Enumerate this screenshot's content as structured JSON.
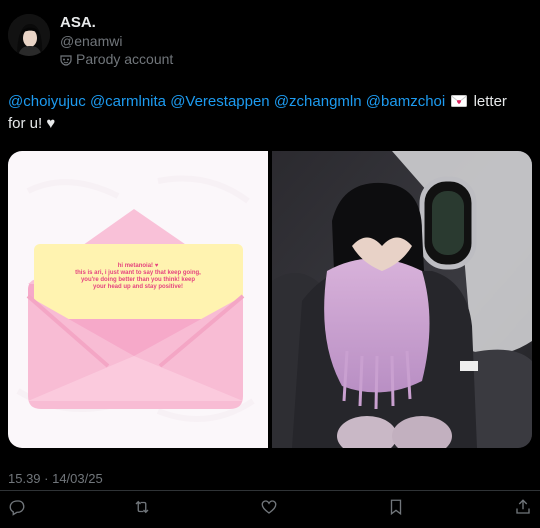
{
  "author": {
    "name": "ASA.",
    "handle": "@enamwi",
    "label": "Parody account",
    "label_icon": "mask-icon"
  },
  "tweet": {
    "mentions": [
      "@choiyujuc",
      "@carmlnita",
      "@Verestappen",
      "@zchangmln",
      "@bamzchoi"
    ],
    "emoji": "love-letter-emoji",
    "line_end": "letter",
    "line2": "for u! ♥"
  },
  "media": {
    "left_letter": {
      "greeting": "hi metanoia! ♥",
      "line1": "this is ari, i just want to say that keep going,",
      "line2": "you're doing better than you think! keep",
      "line3": "your head up and stay positive!"
    }
  },
  "timestamp": "15.39 · 14/03/25",
  "actions": [
    {
      "name": "reply-icon"
    },
    {
      "name": "retweet-icon"
    },
    {
      "name": "like-icon"
    },
    {
      "name": "bookmark-icon"
    },
    {
      "name": "share-icon"
    }
  ],
  "colors": {
    "background": "#000000",
    "text": "#e7e9ea",
    "muted": "#71767b",
    "mention": "#1d9bf0",
    "envelope_pink": "#f7b6cf",
    "letter_yellow": "#fff3b0"
  }
}
